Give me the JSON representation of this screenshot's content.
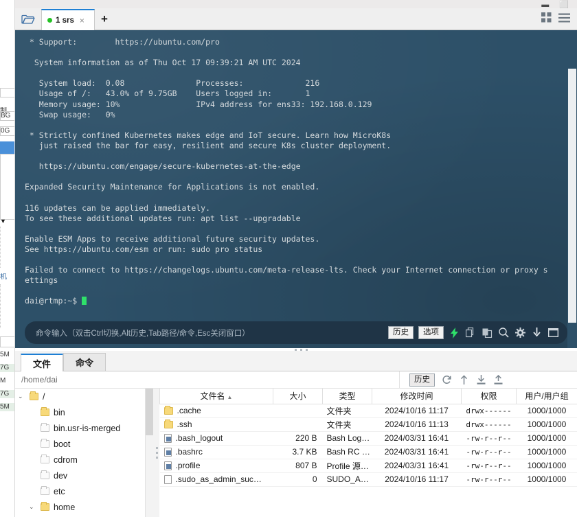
{
  "window": {
    "buttons": [
      "minimize",
      "maximize"
    ]
  },
  "tabbar": {
    "folder_icon": "open-folder-icon",
    "tab": {
      "status": "online",
      "label": "1 srs",
      "close": "×"
    },
    "new_tab": "+",
    "grid_icon": "grid-view-icon",
    "menu_icon": "hamburger-menu-icon"
  },
  "terminal": {
    "background": "#2d5068",
    "lines": [
      " * Support:        https://ubuntu.com/pro",
      "",
      "  System information as of Thu Oct 17 09:39:21 AM UTC 2024",
      "",
      "   System load:  0.08               Processes:             216",
      "   Usage of /:   43.0% of 9.75GB    Users logged in:       1",
      "   Memory usage: 10%                IPv4 address for ens33: 192.168.0.129",
      "   Swap usage:   0%",
      "",
      " * Strictly confined Kubernetes makes edge and IoT secure. Learn how MicroK8s",
      "   just raised the bar for easy, resilient and secure K8s cluster deployment.",
      "",
      "   https://ubuntu.com/engage/secure-kubernetes-at-the-edge",
      "",
      "Expanded Security Maintenance for Applications is not enabled.",
      "",
      "116 updates can be applied immediately.",
      "To see these additional updates run: apt list --upgradable",
      "",
      "Enable ESM Apps to receive additional future security updates.",
      "See https://ubuntu.com/esm or run: sudo pro status",
      "",
      "Failed to connect to https://changelogs.ubuntu.com/meta-release-lts. Check your Internet connection or proxy s",
      "ettings",
      ""
    ],
    "prompt": "dai@rtmp:~$ "
  },
  "command_bar": {
    "placeholder": "命令输入（双击Ctrl切换,Alt历史,Tab路径/命令,Esc关闭窗口）",
    "history_label": "历史",
    "options_label": "选项",
    "icons": [
      "lightning-icon",
      "copy-icon",
      "paste-icon",
      "search-icon",
      "gear-icon",
      "download-icon",
      "window-icon"
    ],
    "accent": "#2fe06a"
  },
  "panel": {
    "tabs": [
      {
        "label": "文件",
        "selected": true
      },
      {
        "label": "命令",
        "selected": false
      }
    ],
    "path": "/home/dai",
    "toolbar": {
      "history_label": "历史",
      "icons": [
        "refresh-icon",
        "up-arrow-icon",
        "download-icon",
        "upload-icon"
      ]
    },
    "tree": [
      {
        "label": "/",
        "depth": 0,
        "expanded": true,
        "icon": "folder-icon"
      },
      {
        "label": "bin",
        "depth": 1,
        "expanded": false,
        "icon": "folder-link-icon"
      },
      {
        "label": "bin.usr-is-merged",
        "depth": 1,
        "expanded": false,
        "icon": "folder-plain-icon"
      },
      {
        "label": "boot",
        "depth": 1,
        "expanded": false,
        "icon": "folder-plain-icon"
      },
      {
        "label": "cdrom",
        "depth": 1,
        "expanded": false,
        "icon": "folder-plain-icon"
      },
      {
        "label": "dev",
        "depth": 1,
        "expanded": false,
        "icon": "folder-plain-icon"
      },
      {
        "label": "etc",
        "depth": 1,
        "expanded": false,
        "icon": "folder-plain-icon"
      },
      {
        "label": "home",
        "depth": 1,
        "expanded": true,
        "icon": "folder-icon"
      }
    ],
    "columns": [
      "文件名",
      "大小",
      "类型",
      "修改时间",
      "权限",
      "用户/用户组"
    ],
    "sort_column": "文件名",
    "sort_dir": "asc",
    "files": [
      {
        "icon": "folder-icon",
        "name": ".cache",
        "size": "",
        "type": "文件夹",
        "mtime": "2024/10/16 11:17",
        "perm": "drwx------",
        "user": "1000/1000"
      },
      {
        "icon": "folder-icon",
        "name": ".ssh",
        "size": "",
        "type": "文件夹",
        "mtime": "2024/10/16 11:13",
        "perm": "drwx------",
        "user": "1000/1000"
      },
      {
        "icon": "file-text-icon",
        "name": ".bash_logout",
        "size": "220 B",
        "type": "Bash Log…",
        "mtime": "2024/03/31 16:41",
        "perm": "-rw-r--r--",
        "user": "1000/1000"
      },
      {
        "icon": "file-text-icon",
        "name": ".bashrc",
        "size": "3.7 KB",
        "type": "Bash RC …",
        "mtime": "2024/03/31 16:41",
        "perm": "-rw-r--r--",
        "user": "1000/1000"
      },
      {
        "icon": "file-text-icon",
        "name": ".profile",
        "size": "807 B",
        "type": "Profile 源…",
        "mtime": "2024/03/31 16:41",
        "perm": "-rw-r--r--",
        "user": "1000/1000"
      },
      {
        "icon": "file-blank-icon",
        "name": ".sudo_as_admin_suc…",
        "size": "0",
        "type": "SUDO_A…",
        "mtime": "2024/10/16 11:17",
        "perm": "-rw-r--r--",
        "user": "1000/1000"
      }
    ]
  },
  "background_window": {
    "fragments": [
      "制",
      "BG",
      "0G",
      "机",
      "5M",
      "7G",
      "M",
      "7G",
      "5M"
    ]
  }
}
